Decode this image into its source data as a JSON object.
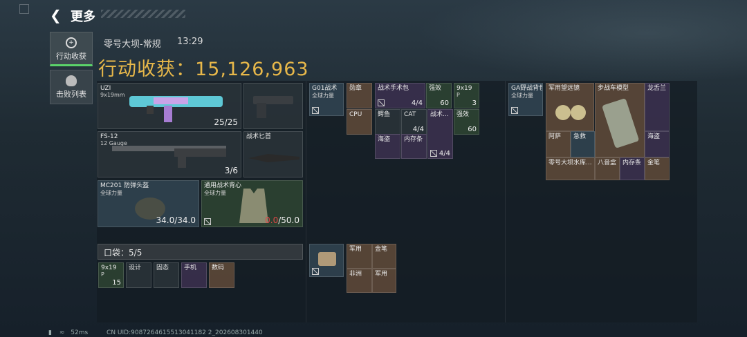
{
  "header": {
    "back_icon": "chevron-left-icon",
    "title": "更多"
  },
  "tabs": [
    {
      "label": "行动收获",
      "icon": "target-icon",
      "active": true
    },
    {
      "label": "击败列表",
      "icon": "skull-icon",
      "active": false
    }
  ],
  "match": {
    "map": "零号大坝-常规",
    "time": "13:29"
  },
  "haul": {
    "label": "行动收获：",
    "value": "15,126,963"
  },
  "loadout": {
    "primary": {
      "name": "UZI",
      "ammo_type": "9x19mm",
      "count": "25/25"
    },
    "secondary": {
      "name": "FS-12",
      "ammo_type": "12 Gauge",
      "count": "3/6"
    },
    "melee": {
      "name": "战术匕首"
    },
    "helmet": {
      "name": "MC201 防弹头盔",
      "sub": "全球力量",
      "durability": "34.0/34.0"
    },
    "armor": {
      "name": "通用战术背心",
      "sub": "全球力量",
      "durability_current": "0.0",
      "durability_max": "/50.0"
    }
  },
  "pockets": {
    "label": "口袋：",
    "count": "5/5",
    "items": [
      {
        "label": "9x19",
        "sub": "P",
        "count": "15"
      },
      {
        "label": "设计"
      },
      {
        "label": "固态"
      },
      {
        "label": "手机"
      },
      {
        "label": "数码"
      }
    ]
  },
  "rig": {
    "name": "G01战术",
    "sub": "全球力量",
    "items": [
      {
        "label": "勋章"
      },
      {
        "label": "战术手术包",
        "count": "4/4"
      },
      {
        "label": "强效",
        "count": "60"
      },
      {
        "label": "9x19",
        "sub": "P",
        "count": "3"
      },
      {
        "label": "CPU"
      },
      {
        "label": "鳄鱼"
      },
      {
        "label": "CAT",
        "count": "4/4"
      },
      {
        "label": "战术...",
        "count": "4/4"
      },
      {
        "label": "强效",
        "count": "60"
      },
      {
        "label": "海盗"
      },
      {
        "label": "内存条"
      }
    ]
  },
  "pouch": {
    "items": [
      {
        "label": "军用"
      },
      {
        "label": "金笔"
      },
      {
        "label": "非洲"
      },
      {
        "label": "军用"
      }
    ]
  },
  "backpack": {
    "name": "GA野战背包",
    "sub": "全球力量",
    "items": [
      {
        "label": "军用望远镜"
      },
      {
        "label": "步战车模型"
      },
      {
        "label": "龙舌兰"
      },
      {
        "label": "阿萨"
      },
      {
        "label": "急救"
      },
      {
        "label": "海盗"
      },
      {
        "label": "零号大坝水库..."
      },
      {
        "label": "八音盒"
      },
      {
        "label": "内存条"
      },
      {
        "label": "金笔"
      }
    ]
  },
  "footer": {
    "ping": "52ms",
    "uid": "CN UID:9087264615513041182 2_202608301440"
  },
  "colors": {
    "accent": "#e8b84a",
    "active_tab": "#5bd36a",
    "warning": "#e04848"
  }
}
